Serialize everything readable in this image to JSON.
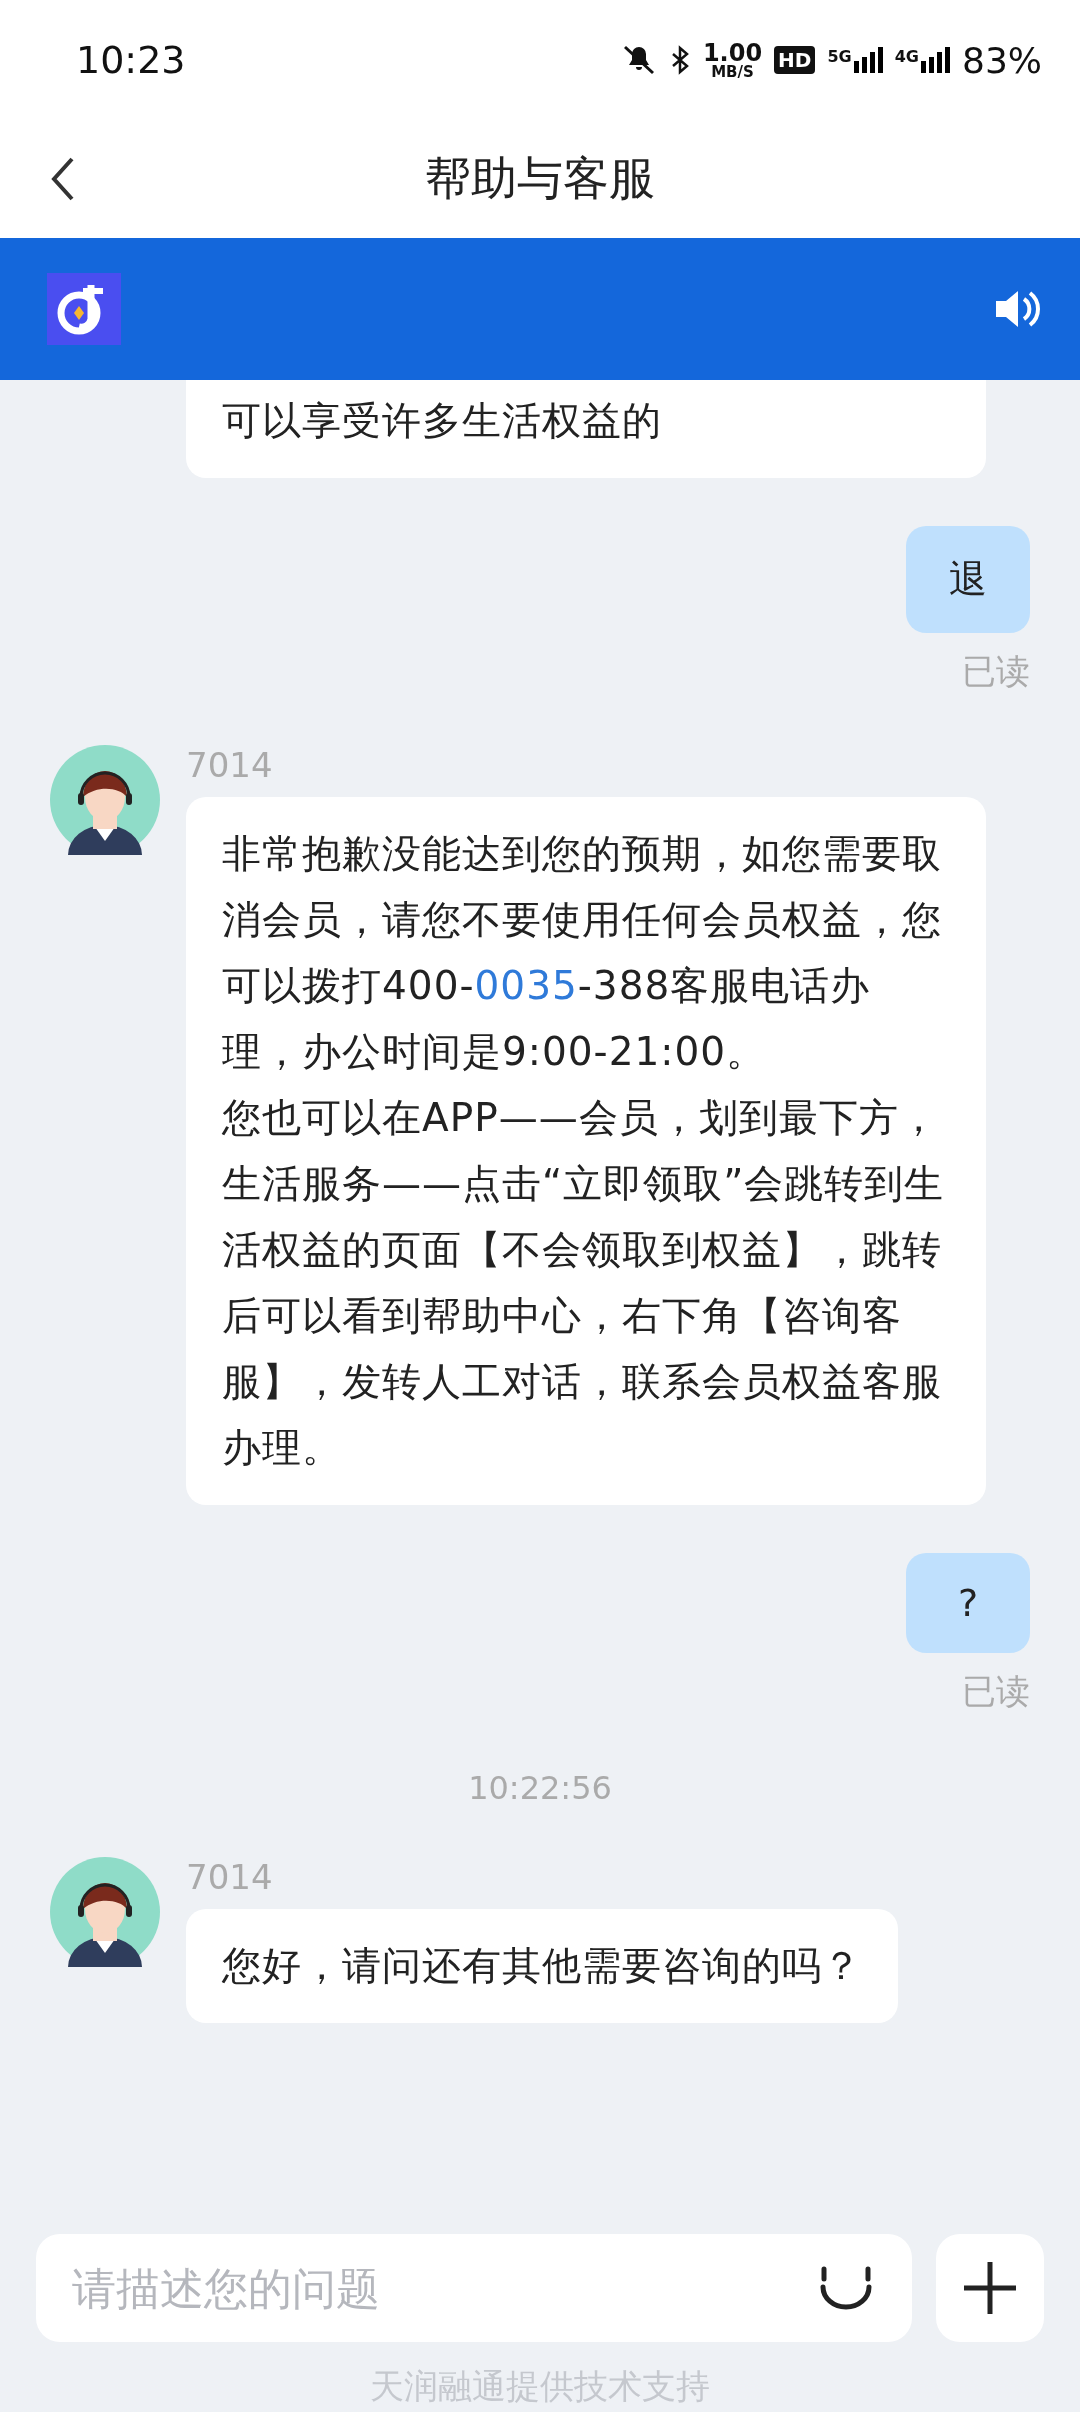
{
  "status_bar": {
    "time": "10:23",
    "speed": "1.00",
    "speed_unit": "MB/S",
    "hd": "HD",
    "sim1": "5G",
    "sim2": "4G",
    "battery": "83%"
  },
  "header": {
    "title": "帮助与客服"
  },
  "messages": [
    {
      "kind": "agent_cont",
      "paragraphs": [
        [
          {
            "kind": "text",
            "text": "可以享受许多生活权益的"
          }
        ]
      ]
    },
    {
      "kind": "user",
      "text": "退",
      "receipt": "已读"
    },
    {
      "kind": "agent",
      "name": "7014",
      "paragraphs": [
        [
          {
            "kind": "text",
            "text": "非常抱歉没能达到您的预期，如您需要取消会员，请您不要使用任何会员权益，您可以拨打400-"
          },
          {
            "kind": "link",
            "text": "0035"
          },
          {
            "kind": "text",
            "text": "-388客服电话办理，办公时间是9:00-21:00。"
          }
        ],
        [
          {
            "kind": "text",
            "text": "您也可以在APP——会员，划到最下方，生活服务——点击“立即领取”会跳转到生活权益的页面【不会领取到权益】，跳转后可以看到帮助中心，右下角【咨询客服】，发转人工对话，联系会员权益客服办理。"
          }
        ]
      ]
    },
    {
      "kind": "user",
      "text": "?",
      "receipt": "已读"
    },
    {
      "kind": "time",
      "text": "10:22:56"
    },
    {
      "kind": "agent",
      "name": "7014",
      "paragraphs": [
        [
          {
            "kind": "text",
            "text": "您好，请问还有其他需要咨询的吗？"
          }
        ]
      ]
    }
  ],
  "input": {
    "placeholder": "请描述您的问题"
  },
  "footer": "天润融通提供技术支持"
}
